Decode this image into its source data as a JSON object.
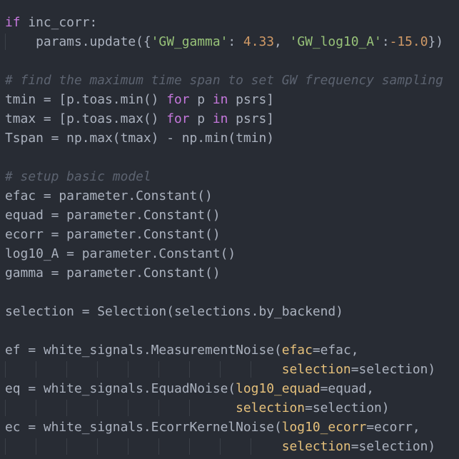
{
  "editor": {
    "language": "python",
    "theme_colors": {
      "background": "#282c34",
      "text": "#abb2bf",
      "keyword": "#c678dd",
      "string": "#98c379",
      "number": "#d19a66",
      "comment": "#5c6370",
      "parameter": "#e5c07b",
      "indent_guide": "#3b4048"
    },
    "lines": [
      {
        "guides": 0,
        "tokens": [
          [
            "kw",
            "if"
          ],
          [
            "plain",
            " inc_corr:"
          ]
        ]
      },
      {
        "guides": 1,
        "tokens": [
          [
            "plain",
            "    params.update({"
          ],
          [
            "str",
            "'GW_gamma'"
          ],
          [
            "plain",
            ": "
          ],
          [
            "num",
            "4.33"
          ],
          [
            "plain",
            ", "
          ],
          [
            "str",
            "'GW_log10_A'"
          ],
          [
            "plain",
            ":"
          ],
          [
            "num",
            "-15.0"
          ],
          [
            "plain",
            "})"
          ]
        ]
      },
      {
        "guides": 0,
        "tokens": []
      },
      {
        "guides": 0,
        "tokens": [
          [
            "cm",
            "# find the maximum time span to set GW frequency sampling"
          ]
        ]
      },
      {
        "guides": 0,
        "tokens": [
          [
            "plain",
            "tmin = [p.toas.min() "
          ],
          [
            "kw",
            "for"
          ],
          [
            "plain",
            " p "
          ],
          [
            "kw",
            "in"
          ],
          [
            "plain",
            " psrs]"
          ]
        ]
      },
      {
        "guides": 0,
        "tokens": [
          [
            "plain",
            "tmax = [p.toas.max() "
          ],
          [
            "kw",
            "for"
          ],
          [
            "plain",
            " p "
          ],
          [
            "kw",
            "in"
          ],
          [
            "plain",
            " psrs]"
          ]
        ]
      },
      {
        "guides": 0,
        "tokens": [
          [
            "plain",
            "Tspan = np.max(tmax) - np.min(tmin)"
          ]
        ]
      },
      {
        "guides": 0,
        "tokens": []
      },
      {
        "guides": 0,
        "tokens": [
          [
            "cm",
            "# setup basic model"
          ]
        ]
      },
      {
        "guides": 0,
        "tokens": [
          [
            "plain",
            "efac = parameter.Constant()"
          ]
        ]
      },
      {
        "guides": 0,
        "tokens": [
          [
            "plain",
            "equad = parameter.Constant()"
          ]
        ]
      },
      {
        "guides": 0,
        "tokens": [
          [
            "plain",
            "ecorr = parameter.Constant()"
          ]
        ]
      },
      {
        "guides": 0,
        "tokens": [
          [
            "plain",
            "log10_A = parameter.Constant()"
          ]
        ]
      },
      {
        "guides": 0,
        "tokens": [
          [
            "plain",
            "gamma = parameter.Constant()"
          ]
        ]
      },
      {
        "guides": 0,
        "tokens": []
      },
      {
        "guides": 0,
        "tokens": [
          [
            "plain",
            "selection = Selection(selections.by_backend)"
          ]
        ]
      },
      {
        "guides": 0,
        "tokens": []
      },
      {
        "guides": 0,
        "tokens": [
          [
            "plain",
            "ef = white_signals.MeasurementNoise("
          ],
          [
            "param",
            "efac"
          ],
          [
            "plain",
            "=efac,"
          ]
        ]
      },
      {
        "guides": 9,
        "tokens": [
          [
            "plain",
            "                                    "
          ],
          [
            "param",
            "selection"
          ],
          [
            "plain",
            "=selection)"
          ]
        ]
      },
      {
        "guides": 0,
        "tokens": [
          [
            "plain",
            "eq = white_signals.EquadNoise("
          ],
          [
            "param",
            "log10_equad"
          ],
          [
            "plain",
            "=equad,"
          ]
        ]
      },
      {
        "guides": 7,
        "tokens": [
          [
            "plain",
            "                              "
          ],
          [
            "param",
            "selection"
          ],
          [
            "plain",
            "=selection)"
          ]
        ]
      },
      {
        "guides": 0,
        "tokens": [
          [
            "plain",
            "ec = white_signals.EcorrKernelNoise("
          ],
          [
            "param",
            "log10_ecorr"
          ],
          [
            "plain",
            "=ecorr,"
          ]
        ]
      },
      {
        "guides": 9,
        "tokens": [
          [
            "plain",
            "                                    "
          ],
          [
            "param",
            "selection"
          ],
          [
            "plain",
            "=selection)"
          ]
        ]
      }
    ]
  }
}
